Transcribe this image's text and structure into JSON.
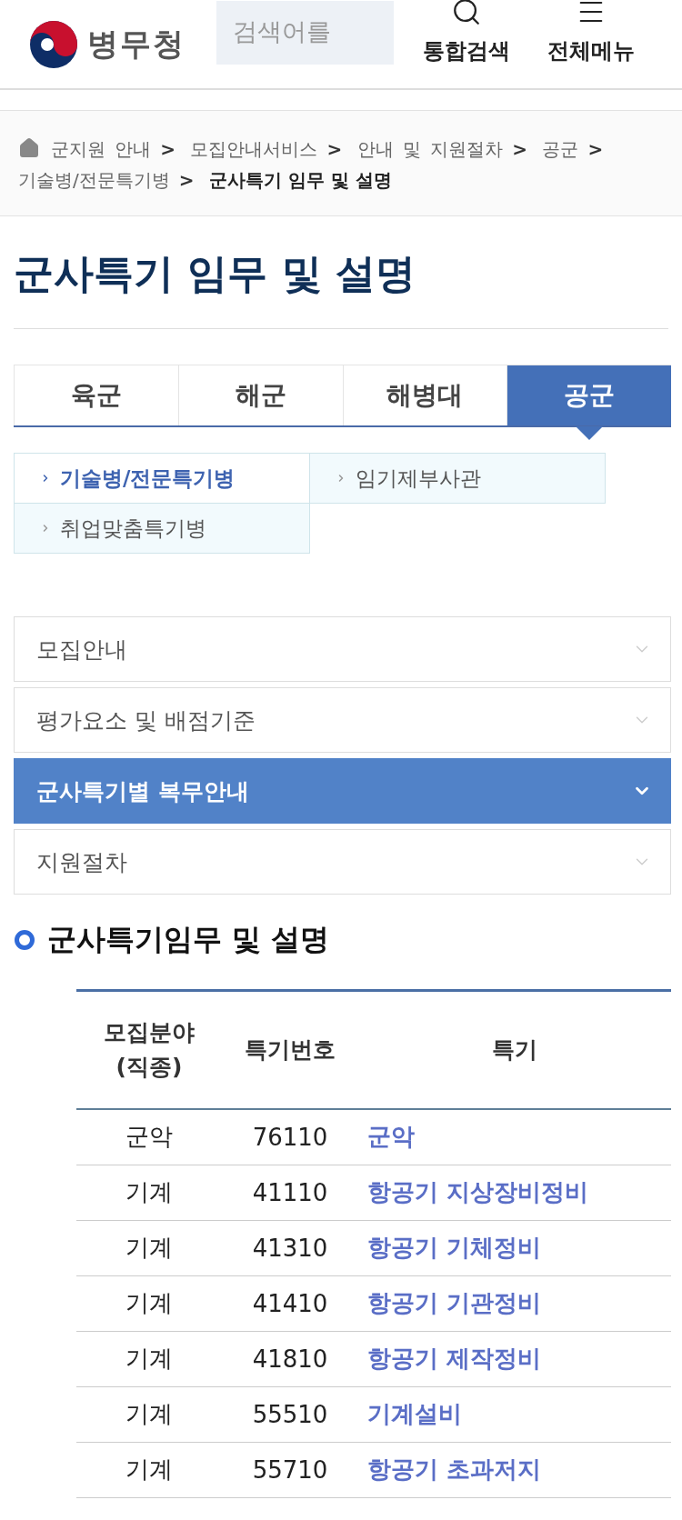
{
  "header": {
    "logo_text": "병무청",
    "search": {
      "placeholder": "검색어를"
    },
    "actions": [
      {
        "kind": "search",
        "label": "통합검색"
      },
      {
        "kind": "menu",
        "label": "전체메뉴"
      }
    ]
  },
  "breadcrumb": {
    "separator": ">",
    "items": [
      "군지원 안내",
      "모집안내서비스",
      "안내 및 지원절차",
      "공군",
      "기술병/전문특기병"
    ],
    "current": "군사특기 임무 및 설명"
  },
  "page_title": "군사특기 임무 및 설명",
  "tabs": [
    {
      "label": "육군",
      "selected": false
    },
    {
      "label": "해군",
      "selected": false
    },
    {
      "label": "해병대",
      "selected": false
    },
    {
      "label": "공군",
      "selected": true
    }
  ],
  "subtabs": [
    {
      "label": "기술병/전문특기병",
      "selected": true
    },
    {
      "label": "임기제부사관",
      "selected": false
    },
    {
      "label": "취업맞춤특기병",
      "selected": false
    }
  ],
  "accordion": [
    {
      "label": "모집안내",
      "expanded": false
    },
    {
      "label": "평가요소 및 배점기준",
      "expanded": false
    },
    {
      "label": "군사특기별 복무안내",
      "expanded": true
    },
    {
      "label": "지원절차",
      "expanded": false
    }
  ],
  "section_title": "군사특기임무 및 설명",
  "table": {
    "columns": [
      "모집분야\n(직종)",
      "특기번호",
      "특기"
    ],
    "rows": [
      [
        "군악",
        "76110",
        "군악"
      ],
      [
        "기계",
        "41110",
        "항공기 지상장비정비"
      ],
      [
        "기계",
        "41310",
        "항공기 기체정비"
      ],
      [
        "기계",
        "41410",
        "항공기 기관정비"
      ],
      [
        "기계",
        "41810",
        "항공기 제작정비"
      ],
      [
        "기계",
        "55510",
        "기계설비"
      ],
      [
        "기계",
        "55710",
        "항공기 초과저지"
      ]
    ]
  }
}
